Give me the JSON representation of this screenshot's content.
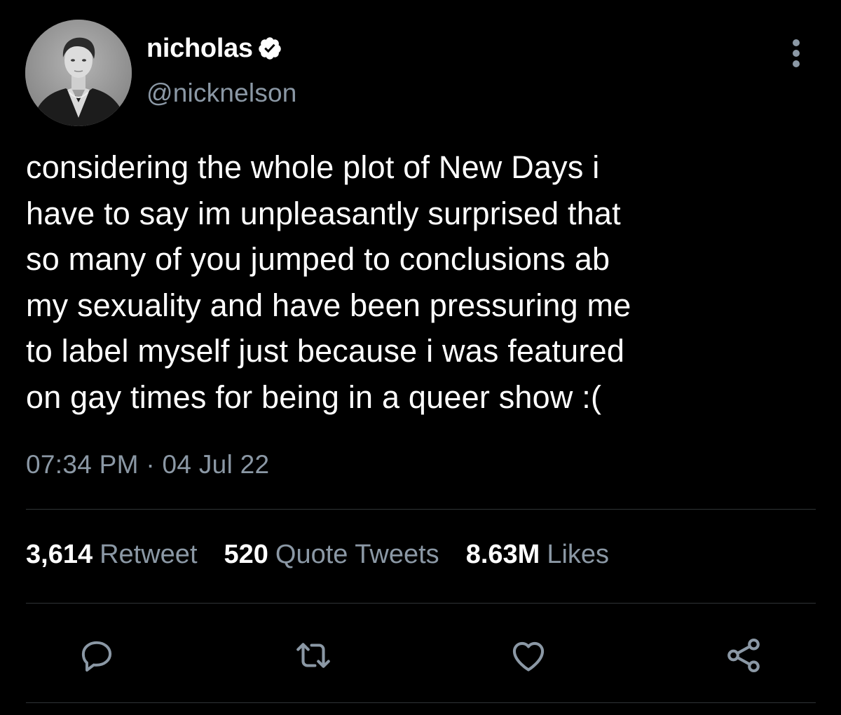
{
  "user": {
    "display_name": "nicholas",
    "handle": "@nicknelson",
    "verified": true
  },
  "tweet": {
    "lines": [
      "considering the whole plot of New Days i",
      "have to say im unpleasantly surprised that",
      "so many of you jumped to conclusions ab",
      "my sexuality and have been pressuring me",
      "to label myself just because i was featured",
      "on gay times for being in a queer show :("
    ],
    "timestamp": "07:34 PM · 04 Jul 22"
  },
  "stats": {
    "retweets": {
      "count": "3,614",
      "label": "Retweet"
    },
    "quotes": {
      "count": "520",
      "label": "Quote Tweets"
    },
    "likes": {
      "count": "8.63M",
      "label": "Likes"
    }
  },
  "icons": {
    "reply": "reply-icon",
    "retweet": "retweet-icon",
    "like": "heart-icon",
    "share": "share-icon",
    "more": "more-icon",
    "verified": "verified-badge-icon"
  },
  "colors": {
    "background": "#000000",
    "text": "#ffffff",
    "secondary": "#8b98a5",
    "divider": "#2f3336"
  }
}
